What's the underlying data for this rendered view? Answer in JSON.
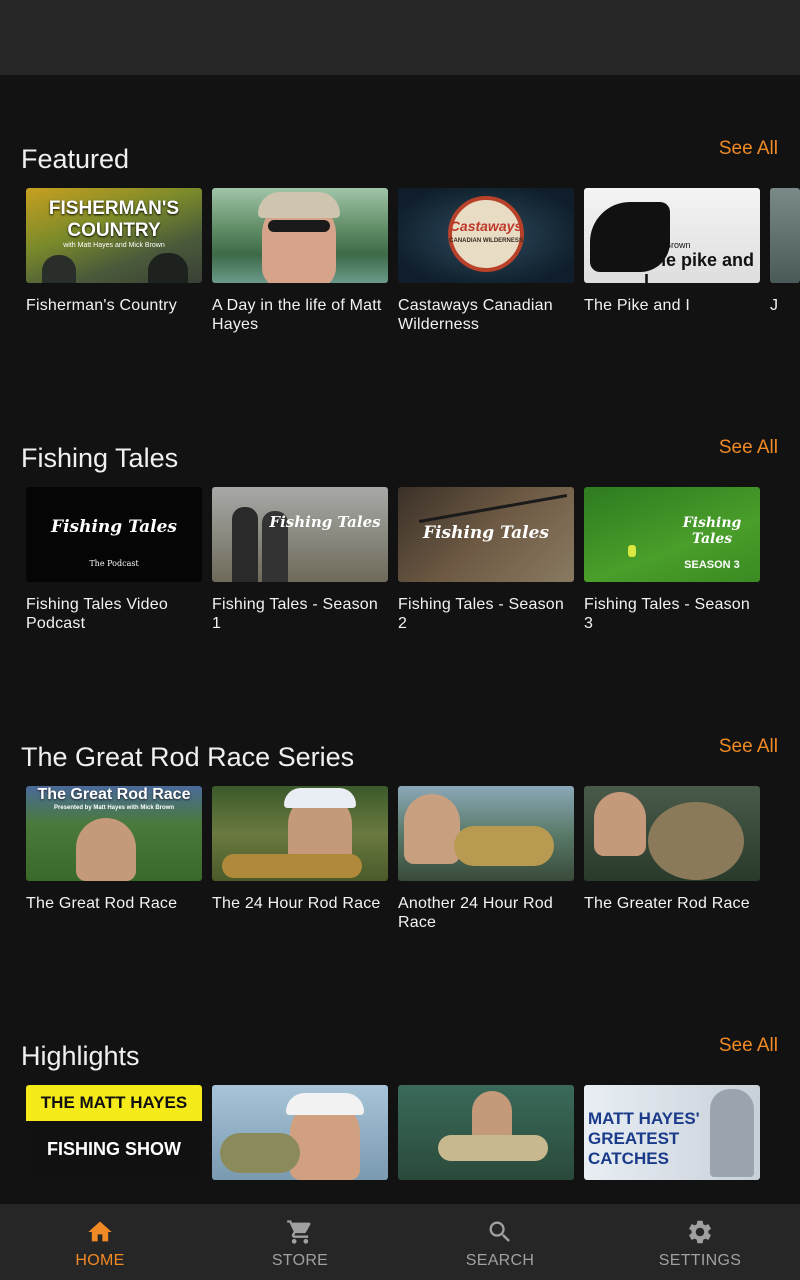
{
  "colors": {
    "accent": "#f08a24",
    "background": "#121212",
    "bar": "#262626"
  },
  "sections": [
    {
      "title": "Featured",
      "see_all": "See All",
      "items": [
        {
          "caption": "Fisherman's Country",
          "thumb_text": "FISHERMAN'S COUNTRY",
          "thumb_sub": "with Matt Hayes and Mick Brown"
        },
        {
          "caption": "A Day in the life of Matt Hayes"
        },
        {
          "caption": "Castaways Canadian Wilderness",
          "thumb_text": "Castaways",
          "thumb_sub": "CANADIAN WILDERNESS"
        },
        {
          "caption": "The Pike and I",
          "thumb_text": "The pike and I",
          "thumb_sub": "Mick Brown"
        },
        {
          "caption": "J"
        }
      ]
    },
    {
      "title": "Fishing Tales",
      "see_all": "See All",
      "items": [
        {
          "caption": "Fishing Tales Video Podcast",
          "thumb_text": "Fishing Tales",
          "thumb_sub": "The Podcast"
        },
        {
          "caption": "Fishing Tales - Season 1",
          "thumb_text": "Fishing Tales"
        },
        {
          "caption": "Fishing Tales - Season 2",
          "thumb_text": "Fishing Tales"
        },
        {
          "caption": "Fishing Tales - Season 3",
          "thumb_text": "Fishing Tales",
          "thumb_sub": "SEASON 3"
        }
      ]
    },
    {
      "title": "The Great Rod Race Series",
      "see_all": "See All",
      "items": [
        {
          "caption": "The Great Rod Race",
          "thumb_text": "The Great Rod Race",
          "thumb_sub": "Presented by Matt Hayes with Mick Brown"
        },
        {
          "caption": "The 24 Hour Rod Race"
        },
        {
          "caption": "Another 24 Hour Rod Race"
        },
        {
          "caption": "The Greater Rod Race"
        }
      ]
    },
    {
      "title": "Highlights",
      "see_all": "See All",
      "items": [
        {
          "caption": "",
          "thumb_text": "THE MATT HAYES",
          "thumb_sub": "FISHING SHOW"
        },
        {
          "caption": ""
        },
        {
          "caption": ""
        },
        {
          "caption": "",
          "thumb_text": "MATT HAYES' GREATEST CATCHES"
        }
      ]
    }
  ],
  "nav": [
    {
      "label": "HOME",
      "icon": "home-icon",
      "active": true
    },
    {
      "label": "STORE",
      "icon": "cart-icon",
      "active": false
    },
    {
      "label": "SEARCH",
      "icon": "search-icon",
      "active": false
    },
    {
      "label": "SETTINGS",
      "icon": "gear-icon",
      "active": false
    }
  ]
}
